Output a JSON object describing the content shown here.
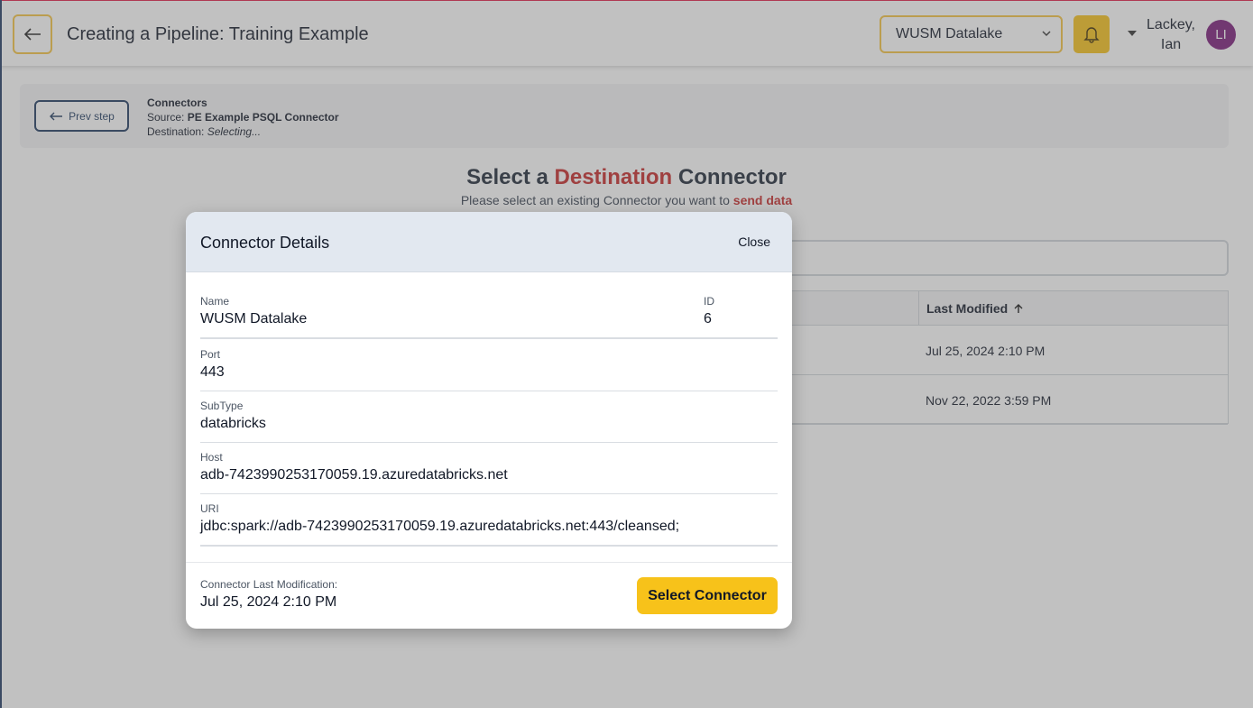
{
  "header": {
    "title": "Creating a Pipeline: Training Example",
    "datasource": "WUSM Datalake",
    "user_name_line1": "Lackey,",
    "user_name_line2": "Ian",
    "avatar_initials": "LI",
    "accent_color": "#f7c21a"
  },
  "steps": {
    "prev_label": "Prev step",
    "section": "Connectors",
    "source_label": "Source: ",
    "source_value": "PE Example PSQL Connector",
    "destination_label": "Destination: ",
    "destination_value": "Selecting..."
  },
  "select": {
    "title_pre": "Select a ",
    "title_highlight": "Destination",
    "title_post": " Connector",
    "subtitle_pre": "Please select an existing Connector you want to ",
    "subtitle_highlight": "send data"
  },
  "table": {
    "col_last_modified": "Last Modified",
    "rows": [
      {
        "last_modified": "Jul 25, 2024 2:10 PM"
      },
      {
        "last_modified": "Nov 22, 2022 3:59 PM"
      }
    ]
  },
  "modal": {
    "title": "Connector Details",
    "close_label": "Close",
    "name_label": "Name",
    "name_value": "WUSM Datalake",
    "id_label": "ID",
    "id_value": "6",
    "port_label": "Port",
    "port_value": "443",
    "subtype_label": "SubType",
    "subtype_value": "databricks",
    "host_label": "Host",
    "host_value": "adb-7423990253170059.19.azuredatabricks.net",
    "uri_label": "URI",
    "uri_value": "jdbc:spark://adb-7423990253170059.19.azuredatabricks.net:443/cleansed;",
    "last_mod_label": "Connector Last Modification:",
    "last_mod_value": "Jul 25, 2024 2:10 PM",
    "select_label": "Select Connector"
  }
}
